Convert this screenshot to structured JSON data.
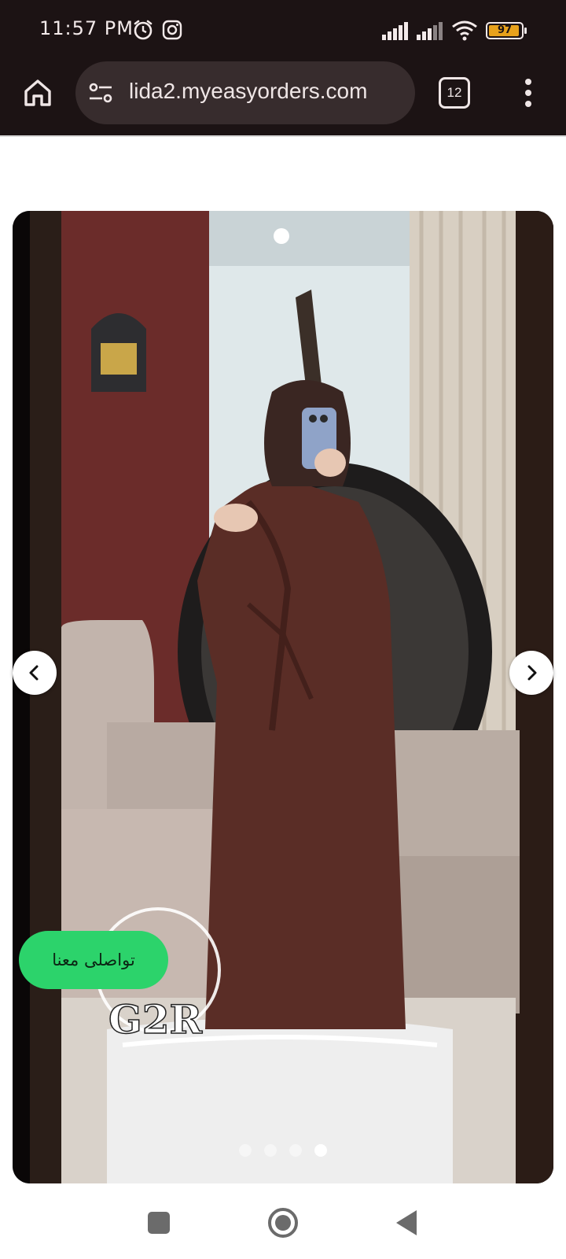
{
  "status_bar": {
    "time": "11:57 PM",
    "battery": "97",
    "icons": [
      "alarm-icon",
      "instagram-icon",
      "signal-icon",
      "signal-icon",
      "wifi-icon",
      "battery-icon"
    ]
  },
  "browser": {
    "url": "lida2.myeasyorders.com",
    "tab_count": "12",
    "icons": [
      "home-icon",
      "site-settings-icon",
      "tabs-icon",
      "more-vert-icon"
    ]
  },
  "gallery": {
    "dots_total": 4,
    "active_index": 3,
    "watermark": "G2R",
    "icons": [
      "chevron-left-icon",
      "chevron-right-icon"
    ]
  },
  "contact": {
    "label": "تواصلى معنا"
  },
  "system_nav": {
    "icons": [
      "recents-icon",
      "home-circle-icon",
      "back-icon"
    ]
  },
  "colors": {
    "browser_bg": "#1c1314",
    "url_bg": "#372c2d",
    "contact_green": "#2cd36b"
  }
}
